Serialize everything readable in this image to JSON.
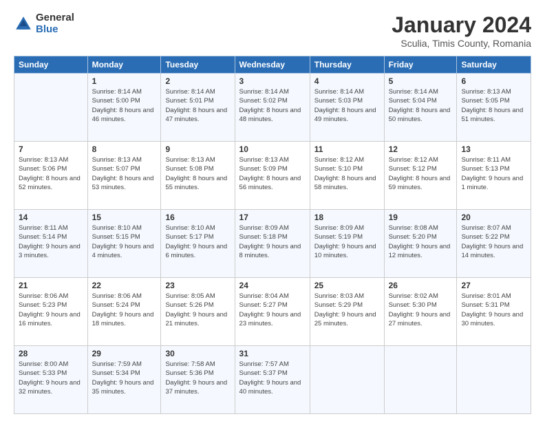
{
  "logo": {
    "general": "General",
    "blue": "Blue"
  },
  "header": {
    "title": "January 2024",
    "subtitle": "Sculia, Timis County, Romania"
  },
  "days_of_week": [
    "Sunday",
    "Monday",
    "Tuesday",
    "Wednesday",
    "Thursday",
    "Friday",
    "Saturday"
  ],
  "weeks": [
    [
      {
        "num": "",
        "info": ""
      },
      {
        "num": "1",
        "info": "Sunrise: 8:14 AM\nSunset: 5:00 PM\nDaylight: 8 hours\nand 46 minutes."
      },
      {
        "num": "2",
        "info": "Sunrise: 8:14 AM\nSunset: 5:01 PM\nDaylight: 8 hours\nand 47 minutes."
      },
      {
        "num": "3",
        "info": "Sunrise: 8:14 AM\nSunset: 5:02 PM\nDaylight: 8 hours\nand 48 minutes."
      },
      {
        "num": "4",
        "info": "Sunrise: 8:14 AM\nSunset: 5:03 PM\nDaylight: 8 hours\nand 49 minutes."
      },
      {
        "num": "5",
        "info": "Sunrise: 8:14 AM\nSunset: 5:04 PM\nDaylight: 8 hours\nand 50 minutes."
      },
      {
        "num": "6",
        "info": "Sunrise: 8:13 AM\nSunset: 5:05 PM\nDaylight: 8 hours\nand 51 minutes."
      }
    ],
    [
      {
        "num": "7",
        "info": "Sunrise: 8:13 AM\nSunset: 5:06 PM\nDaylight: 8 hours\nand 52 minutes."
      },
      {
        "num": "8",
        "info": "Sunrise: 8:13 AM\nSunset: 5:07 PM\nDaylight: 8 hours\nand 53 minutes."
      },
      {
        "num": "9",
        "info": "Sunrise: 8:13 AM\nSunset: 5:08 PM\nDaylight: 8 hours\nand 55 minutes."
      },
      {
        "num": "10",
        "info": "Sunrise: 8:13 AM\nSunset: 5:09 PM\nDaylight: 8 hours\nand 56 minutes."
      },
      {
        "num": "11",
        "info": "Sunrise: 8:12 AM\nSunset: 5:10 PM\nDaylight: 8 hours\nand 58 minutes."
      },
      {
        "num": "12",
        "info": "Sunrise: 8:12 AM\nSunset: 5:12 PM\nDaylight: 8 hours\nand 59 minutes."
      },
      {
        "num": "13",
        "info": "Sunrise: 8:11 AM\nSunset: 5:13 PM\nDaylight: 9 hours\nand 1 minute."
      }
    ],
    [
      {
        "num": "14",
        "info": "Sunrise: 8:11 AM\nSunset: 5:14 PM\nDaylight: 9 hours\nand 3 minutes."
      },
      {
        "num": "15",
        "info": "Sunrise: 8:10 AM\nSunset: 5:15 PM\nDaylight: 9 hours\nand 4 minutes."
      },
      {
        "num": "16",
        "info": "Sunrise: 8:10 AM\nSunset: 5:17 PM\nDaylight: 9 hours\nand 6 minutes."
      },
      {
        "num": "17",
        "info": "Sunrise: 8:09 AM\nSunset: 5:18 PM\nDaylight: 9 hours\nand 8 minutes."
      },
      {
        "num": "18",
        "info": "Sunrise: 8:09 AM\nSunset: 5:19 PM\nDaylight: 9 hours\nand 10 minutes."
      },
      {
        "num": "19",
        "info": "Sunrise: 8:08 AM\nSunset: 5:20 PM\nDaylight: 9 hours\nand 12 minutes."
      },
      {
        "num": "20",
        "info": "Sunrise: 8:07 AM\nSunset: 5:22 PM\nDaylight: 9 hours\nand 14 minutes."
      }
    ],
    [
      {
        "num": "21",
        "info": "Sunrise: 8:06 AM\nSunset: 5:23 PM\nDaylight: 9 hours\nand 16 minutes."
      },
      {
        "num": "22",
        "info": "Sunrise: 8:06 AM\nSunset: 5:24 PM\nDaylight: 9 hours\nand 18 minutes."
      },
      {
        "num": "23",
        "info": "Sunrise: 8:05 AM\nSunset: 5:26 PM\nDaylight: 9 hours\nand 21 minutes."
      },
      {
        "num": "24",
        "info": "Sunrise: 8:04 AM\nSunset: 5:27 PM\nDaylight: 9 hours\nand 23 minutes."
      },
      {
        "num": "25",
        "info": "Sunrise: 8:03 AM\nSunset: 5:29 PM\nDaylight: 9 hours\nand 25 minutes."
      },
      {
        "num": "26",
        "info": "Sunrise: 8:02 AM\nSunset: 5:30 PM\nDaylight: 9 hours\nand 27 minutes."
      },
      {
        "num": "27",
        "info": "Sunrise: 8:01 AM\nSunset: 5:31 PM\nDaylight: 9 hours\nand 30 minutes."
      }
    ],
    [
      {
        "num": "28",
        "info": "Sunrise: 8:00 AM\nSunset: 5:33 PM\nDaylight: 9 hours\nand 32 minutes."
      },
      {
        "num": "29",
        "info": "Sunrise: 7:59 AM\nSunset: 5:34 PM\nDaylight: 9 hours\nand 35 minutes."
      },
      {
        "num": "30",
        "info": "Sunrise: 7:58 AM\nSunset: 5:36 PM\nDaylight: 9 hours\nand 37 minutes."
      },
      {
        "num": "31",
        "info": "Sunrise: 7:57 AM\nSunset: 5:37 PM\nDaylight: 9 hours\nand 40 minutes."
      },
      {
        "num": "",
        "info": ""
      },
      {
        "num": "",
        "info": ""
      },
      {
        "num": "",
        "info": ""
      }
    ]
  ]
}
